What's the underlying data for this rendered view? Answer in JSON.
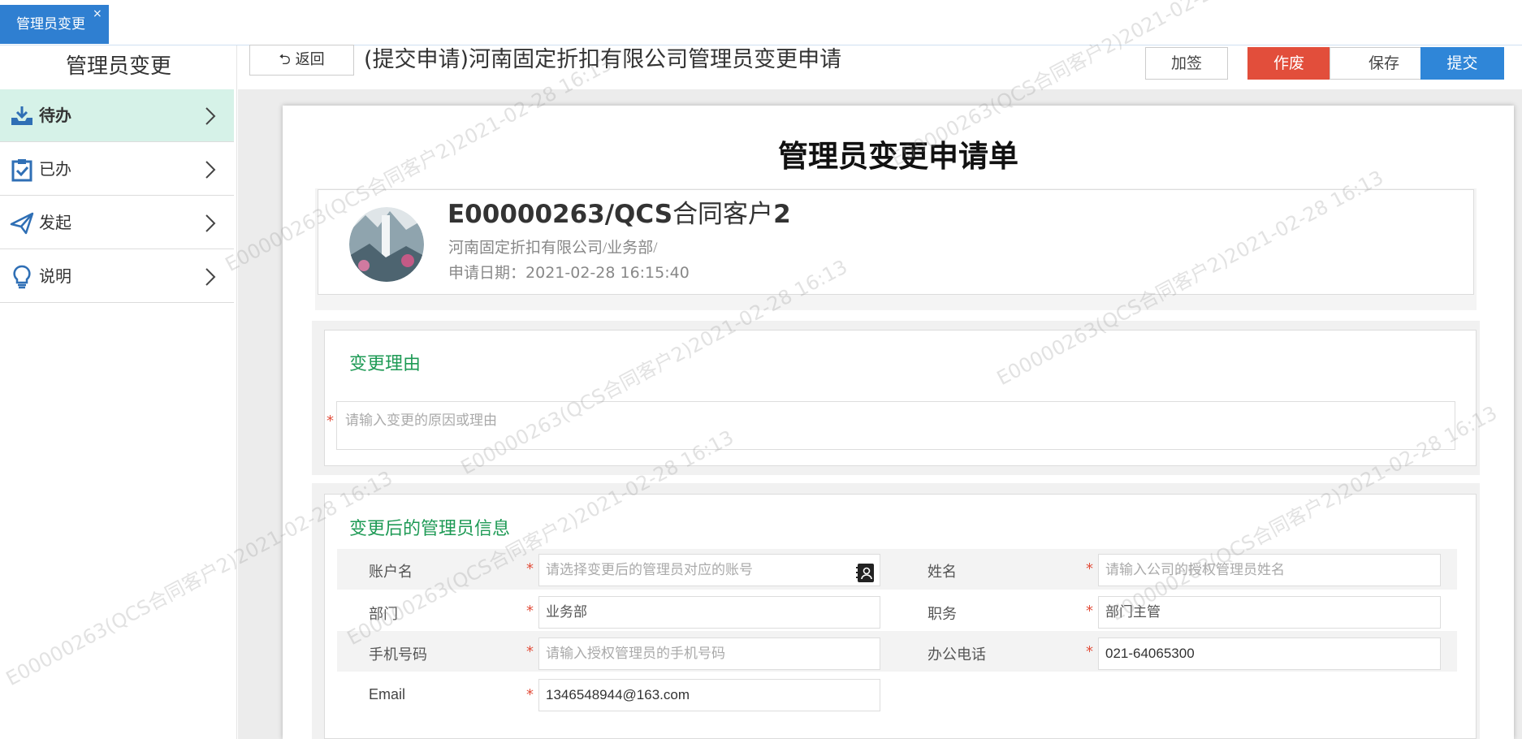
{
  "tab": {
    "label": "管理员变更",
    "close": "×"
  },
  "sidebar": {
    "title": "管理员变更",
    "items": [
      {
        "label": "待办",
        "icon": "inbox-download-icon"
      },
      {
        "label": "已办",
        "icon": "clipboard-check-icon"
      },
      {
        "label": "发起",
        "icon": "paper-plane-icon"
      },
      {
        "label": "说明",
        "icon": "lightbulb-icon"
      }
    ]
  },
  "toolbar": {
    "back_label": "返回",
    "title": "(提交申请)河南固定折扣有限公司管理员变更申请",
    "sign_label": "加签",
    "void_label": "作废",
    "save_label": "保存",
    "submit_label": "提交"
  },
  "form": {
    "title": "管理员变更申请单",
    "applicant": {
      "id": "E00000263/QCS",
      "name_suffix": "合同客户",
      "num": "2",
      "org": "河南固定折扣有限公司/业务部/",
      "date_label": "申请日期：",
      "date": "2021-02-28 16:15:40"
    },
    "reason": {
      "title": "变更理由",
      "placeholder": "请输入变更的原因或理由"
    },
    "admin": {
      "title": "变更后的管理员信息",
      "fields": {
        "account_label": "账户名",
        "account_placeholder": "请选择变更后的管理员对应的账号",
        "name_label": "姓名",
        "name_placeholder": "请输入公司的授权管理员姓名",
        "dept_label": "部门",
        "dept_value": "业务部",
        "position_label": "职务",
        "position_value": "部门主管",
        "mobile_label": "手机号码",
        "mobile_placeholder": "请输入授权管理员的手机号码",
        "phone_label": "办公电话",
        "phone_value": "021-64065300",
        "email_label": "Email",
        "email_value": "1346548944@163.com"
      }
    }
  },
  "watermark": "E00000263(QCS合同客户2)2021-02-28 16:13",
  "colors": {
    "primary": "#2f7fd1",
    "danger": "#e24e3b",
    "section_title": "#1e9a55",
    "active_bg": "#d6f2e8"
  }
}
